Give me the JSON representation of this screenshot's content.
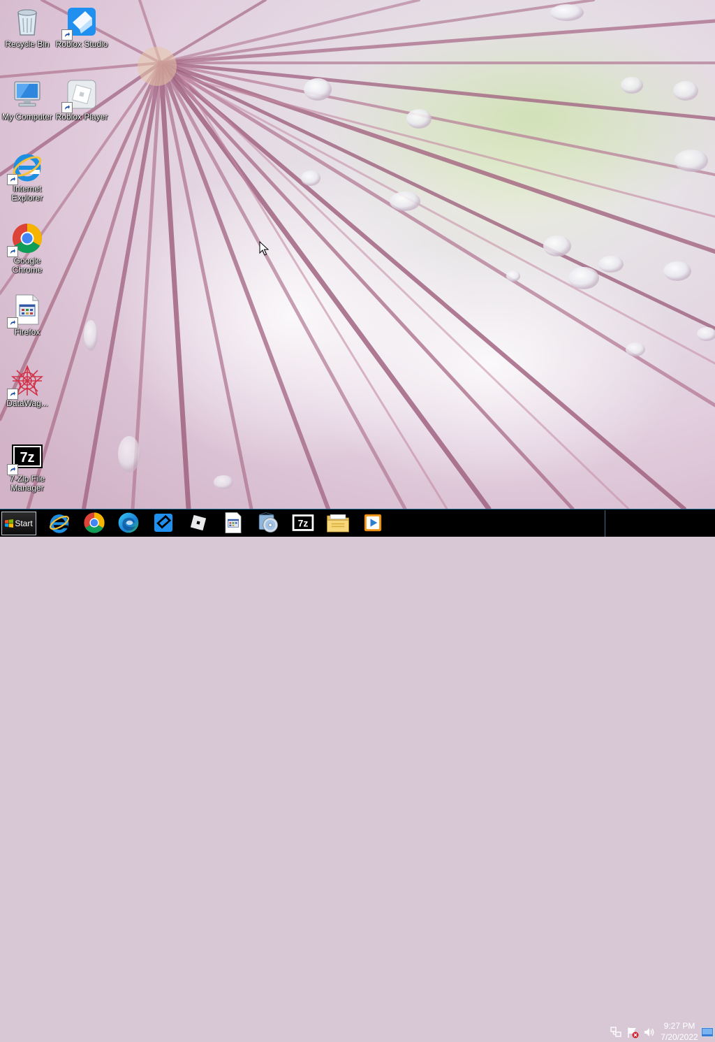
{
  "desktop": {
    "icons": [
      {
        "label": "Recycle Bin",
        "icon": "recycle-bin-icon"
      },
      {
        "label": "Roblox Studio",
        "icon": "roblox-studio-icon"
      },
      {
        "label": "My Computer",
        "icon": "my-computer-icon"
      },
      {
        "label": "Roblox Player",
        "icon": "roblox-player-icon"
      },
      {
        "label": "Internet Explorer",
        "icon": "internet-explorer-icon"
      },
      {
        "label": "Google Chrome",
        "icon": "google-chrome-icon"
      },
      {
        "label": "Firefox",
        "icon": "firefox-icon"
      },
      {
        "label": "DataWag...",
        "icon": "datawag-icon"
      },
      {
        "label": "7-Zip File Manager",
        "icon": "7zip-icon"
      }
    ]
  },
  "taskbar": {
    "start_label": "Start",
    "pinned": [
      {
        "icon": "internet-explorer-icon"
      },
      {
        "icon": "google-chrome-icon"
      },
      {
        "icon": "edge-icon"
      },
      {
        "icon": "roblox-studio-icon"
      },
      {
        "icon": "roblox-player-icon"
      },
      {
        "icon": "app-window-icon"
      },
      {
        "icon": "media-disc-icon"
      },
      {
        "icon": "7zip-icon"
      },
      {
        "icon": "file-explorer-icon"
      },
      {
        "icon": "media-player-icon"
      }
    ],
    "tray": {
      "icons": [
        "network-icon",
        "action-center-flag-icon",
        "volume-icon",
        "show-desktop-icon"
      ],
      "time": "9:27 PM",
      "date": "7/20/2022"
    }
  },
  "colors": {
    "taskbar": "#000000",
    "taskbar_border": "#1a6a94",
    "icon_label_text": "#ffffff"
  }
}
